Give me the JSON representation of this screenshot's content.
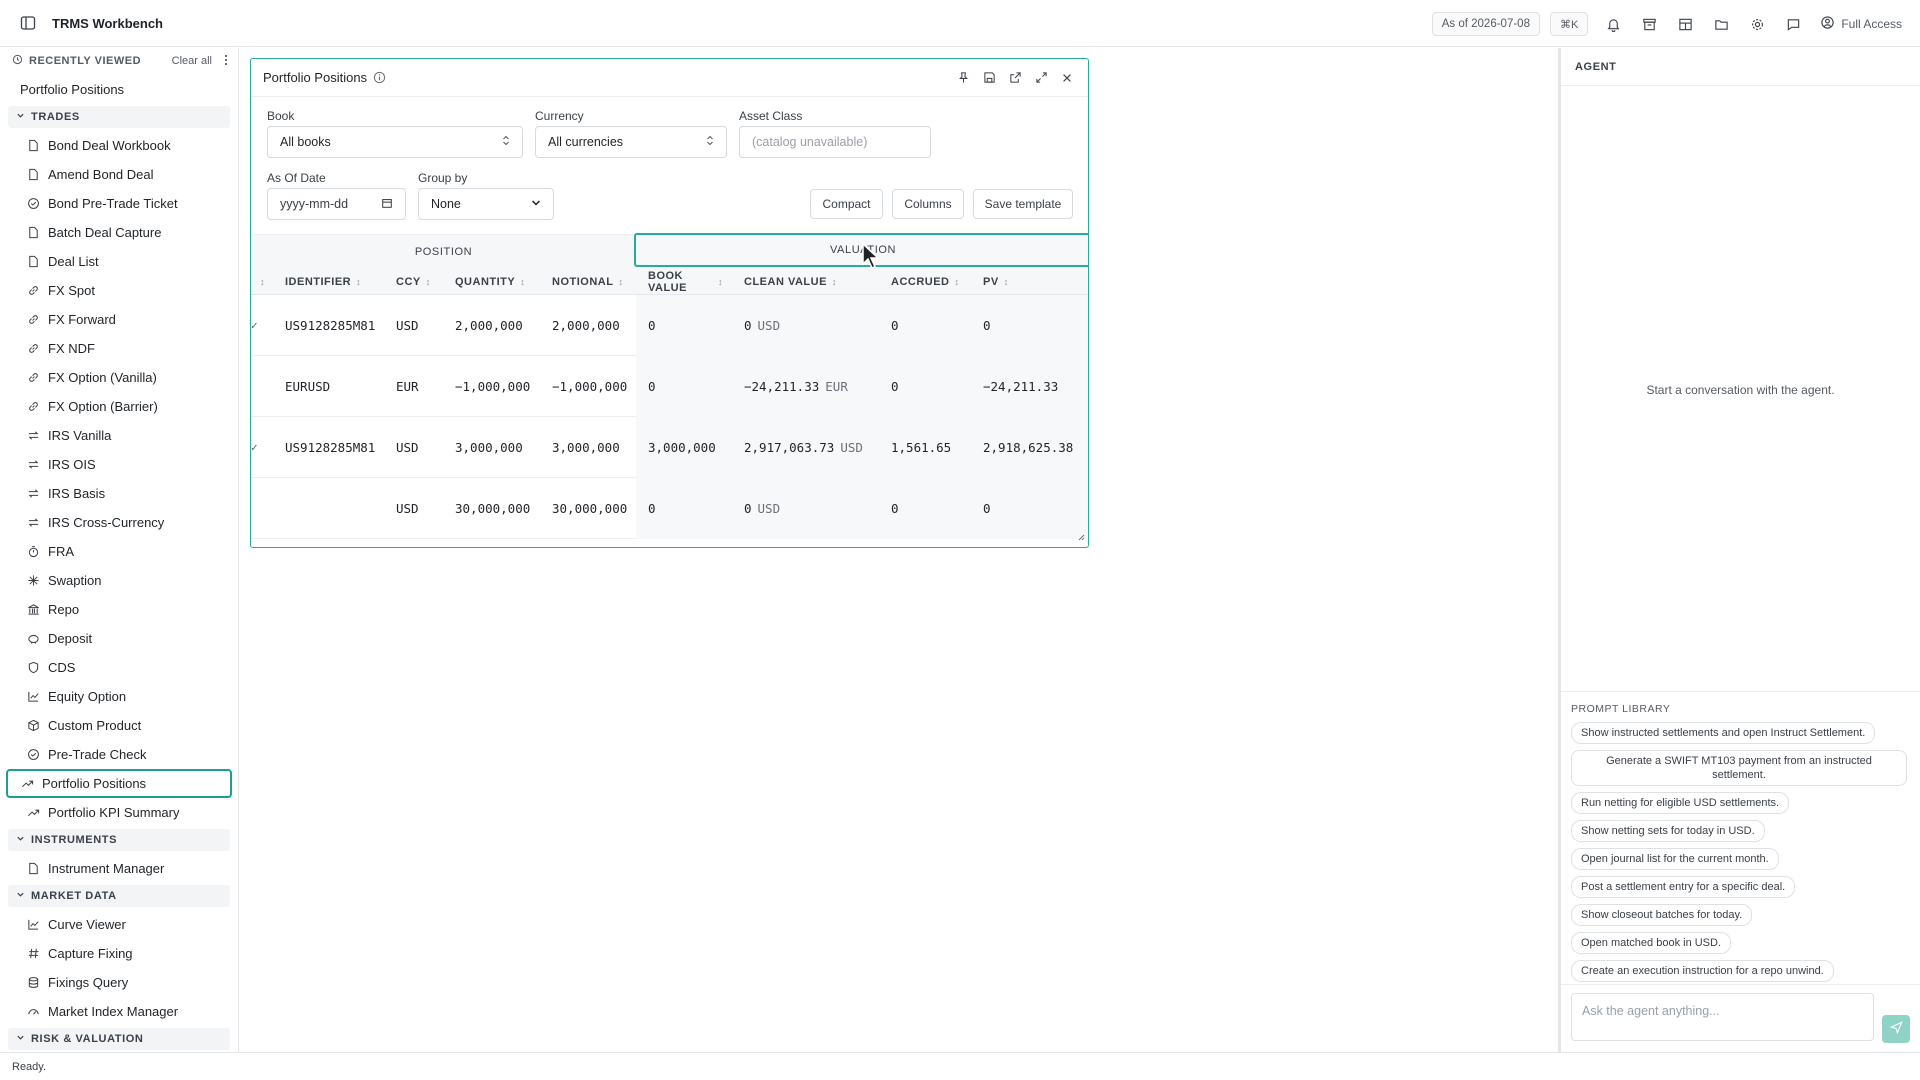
{
  "app": {
    "title": "TRMS Workbench"
  },
  "topbar": {
    "as_of": "As of 2026-07-08",
    "shortcut": "⌘K",
    "access": "Full Access"
  },
  "sidebar": {
    "recent_title": "RECENTLY VIEWED",
    "clear_all": "Clear all",
    "recent_items": [
      "Portfolio Positions"
    ],
    "sections": {
      "trades": "TRADES",
      "instruments": "INSTRUMENTS",
      "market_data": "MARKET DATA",
      "risk": "RISK & VALUATION"
    },
    "trades": [
      "Bond Deal Workbook",
      "Amend Bond Deal",
      "Bond Pre-Trade Ticket",
      "Batch Deal Capture",
      "Deal List",
      "FX Spot",
      "FX Forward",
      "FX NDF",
      "FX Option (Vanilla)",
      "FX Option (Barrier)",
      "IRS Vanilla",
      "IRS OIS",
      "IRS Basis",
      "IRS Cross-Currency",
      "FRA",
      "Swaption",
      "Repo",
      "Deposit",
      "CDS",
      "Equity Option",
      "Custom Product",
      "Pre-Trade Check",
      "Portfolio Positions",
      "Portfolio KPI Summary"
    ],
    "instruments": [
      "Instrument Manager"
    ],
    "market_data": [
      "Curve Viewer",
      "Capture Fixing",
      "Fixings Query",
      "Market Index Manager"
    ]
  },
  "widget": {
    "title": "Portfolio Positions",
    "filters": {
      "book_label": "Book",
      "book_value": "All books",
      "currency_label": "Currency",
      "currency_value": "All currencies",
      "asset_class_label": "Asset Class",
      "asset_class_placeholder": "(catalog unavailable)",
      "as_of_label": "As Of Date",
      "as_of_placeholder": "yyyy-mm-dd",
      "group_by_label": "Group by",
      "group_by_value": "None"
    },
    "buttons": {
      "compact": "Compact",
      "columns": "Columns",
      "save_template": "Save template"
    },
    "grid": {
      "group_position": "POSITION",
      "group_valuation": "VALUATION",
      "columns": [
        "IDENTIFIER",
        "CCY",
        "QUANTITY",
        "NOTIONAL",
        "BOOK VALUE",
        "CLEAN VALUE",
        "ACCRUED",
        "PV"
      ],
      "rows": [
        {
          "identifier": "US9128285M81",
          "ccy": "USD",
          "quantity": "2,000,000",
          "notional": "2,000,000",
          "book_value": "0",
          "clean_value": "0",
          "clean_ccy": "USD",
          "accrued": "0",
          "pv": "0"
        },
        {
          "identifier": "EURUSD",
          "ccy": "EUR",
          "quantity": "−1,000,000",
          "notional": "−1,000,000",
          "book_value": "0",
          "clean_value": "−24,211.33",
          "clean_ccy": "EUR",
          "accrued": "0",
          "pv": "−24,211.33"
        },
        {
          "identifier": "US9128285M81",
          "ccy": "USD",
          "quantity": "3,000,000",
          "notional": "3,000,000",
          "book_value": "3,000,000",
          "clean_value": "2,917,063.73",
          "clean_ccy": "USD",
          "accrued": "1,561.65",
          "pv": "2,918,625.38"
        },
        {
          "identifier": "",
          "ccy": "USD",
          "quantity": "30,000,000",
          "notional": "30,000,000",
          "book_value": "0",
          "clean_value": "0",
          "clean_ccy": "USD",
          "accrued": "0",
          "pv": "0"
        }
      ]
    }
  },
  "agent": {
    "title": "AGENT",
    "empty": "Start a conversation with the agent.",
    "prompt_library_title": "PROMPT LIBRARY",
    "prompts": [
      "Show instructed settlements and open Instruct Settlement.",
      "Generate a SWIFT MT103 payment from an instructed settlement.",
      "Run netting for eligible USD settlements.",
      "Show netting sets for today in USD.",
      "Open journal list for the current month.",
      "Post a settlement entry for a specific deal.",
      "Show closeout batches for today.",
      "Open matched book in USD.",
      "Create an execution instruction for a repo unwind."
    ],
    "input_placeholder": "Ask the agent anything..."
  },
  "status": {
    "text": "Ready."
  },
  "colors": {
    "accent": "#2ba99b",
    "send": "#8fd2c6"
  }
}
